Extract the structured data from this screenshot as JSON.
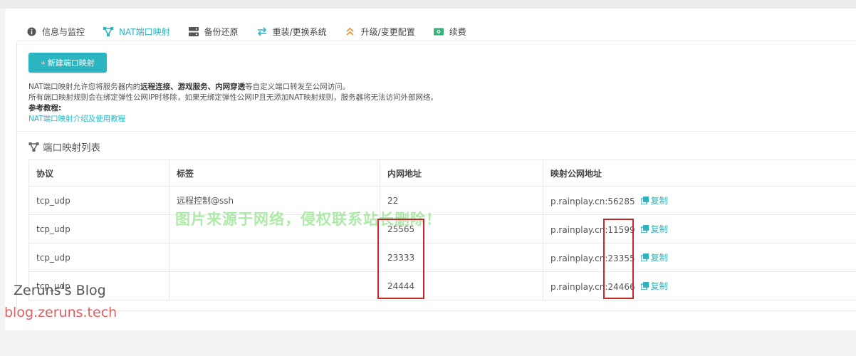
{
  "tabs": [
    {
      "label": "信息与监控",
      "icon": "info-icon"
    },
    {
      "label": "NAT端口映射",
      "icon": "share-nodes-icon",
      "active": true
    },
    {
      "label": "备份还原",
      "icon": "server-icon"
    },
    {
      "label": "重装/更换系统",
      "icon": "swap-arrows-icon"
    },
    {
      "label": "升级/变更配置",
      "icon": "double-chevron-up-icon"
    },
    {
      "label": "续费",
      "icon": "money-icon"
    }
  ],
  "add_button_label": "+ 新建端口映射",
  "description": {
    "line1_a": "NAT端口映射允许您将服务器内的",
    "line1_b": "远程连接、游戏服务、内网穿透",
    "line1_c": "等自定义端口转发至公网访问。",
    "line2": "所有端口映射规则会在绑定弹性公网IP时移除，如果无绑定弹性公网IP且无添加NAT映射规则，服务器将无法访问外部网络。",
    "ref_label": "参考教程:",
    "ref_link": "NAT端口映射介绍及使用教程"
  },
  "section_title": "端口映射列表",
  "table": {
    "headers": [
      "协议",
      "标签",
      "内网地址",
      "映射公网地址"
    ],
    "copy_label": "复制",
    "rows": [
      {
        "protocol": "tcp_udp",
        "tag": "远程控制@ssh",
        "internal": "22",
        "public": "p.rainplay.cn:56285"
      },
      {
        "protocol": "tcp_udp",
        "tag": "",
        "internal": "25565",
        "public": "p.rainplay.cn:11599"
      },
      {
        "protocol": "tcp_udp",
        "tag": "",
        "internal": "23333",
        "public": "p.rainplay.cn:23355"
      },
      {
        "protocol": "tcp_udp",
        "tag": "",
        "internal": "24444",
        "public": "p.rainplay.cn:24466"
      }
    ]
  },
  "watermark": "图片来源于网络，侵权联系站长删除！",
  "blog": {
    "name": "Zeruns's Blog",
    "url": "blog.zeruns.tech"
  },
  "colors": {
    "accent": "#2ab5c1",
    "highlight_box": "#c82828",
    "blog_url": "#e06060"
  }
}
